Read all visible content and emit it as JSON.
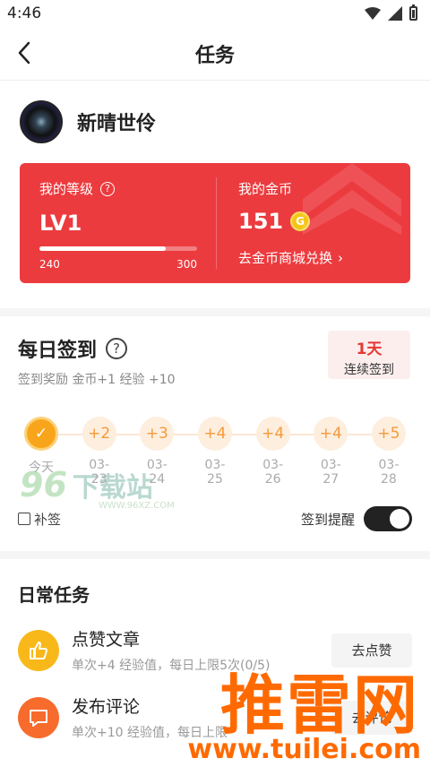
{
  "status": {
    "time": "4:46"
  },
  "header": {
    "title": "任务"
  },
  "user": {
    "name": "新晴世伶"
  },
  "card": {
    "level_label": "我的等级",
    "help": "?",
    "level": "LV1",
    "progress_min": "240",
    "progress_max": "300",
    "progress_fraction": 0.8,
    "coins_label": "我的金币",
    "coins": "151",
    "coin_symbol": "G",
    "exchange_label": "去金币商城兑换",
    "exchange_arrow": "›"
  },
  "checkin": {
    "title": "每日签到",
    "help": "?",
    "subtitle": "签到奖励 金币+1 经验 +10",
    "streak_num": "1天",
    "streak_label": "连续签到",
    "days": [
      {
        "value": "✓",
        "label": "今天",
        "done": true
      },
      {
        "value": "+2",
        "label": "03-23"
      },
      {
        "value": "+3",
        "label": "03-24"
      },
      {
        "value": "+4",
        "label": "03-25"
      },
      {
        "value": "+4",
        "label": "03-26"
      },
      {
        "value": "+4",
        "label": "03-27"
      },
      {
        "value": "+5",
        "label": "03-28"
      }
    ],
    "makeup_label": "补签",
    "remind_label": "签到提醒",
    "remind_on": true
  },
  "tasks": {
    "title": "日常任务",
    "items": [
      {
        "name": "点赞文章",
        "desc": "单次+4 经验值，每日上限5次(0/5)",
        "button": "去点赞",
        "color": "#f8b81a"
      },
      {
        "name": "发布评论",
        "desc": "单次+10 经验值，每日上限",
        "button": "去评论",
        "color": "#f76b2d"
      }
    ]
  },
  "watermarks": {
    "w1_num": "96",
    "w1_text": "下载站",
    "w1_url": "WWW.96XZ.COM",
    "w2_text": "推雷网",
    "w2_url": "www.tuilei.com"
  },
  "colors": {
    "accent_red": "#ec3b3f",
    "coin_gold": "#f5c518",
    "day_orange": "#f8a51c"
  }
}
